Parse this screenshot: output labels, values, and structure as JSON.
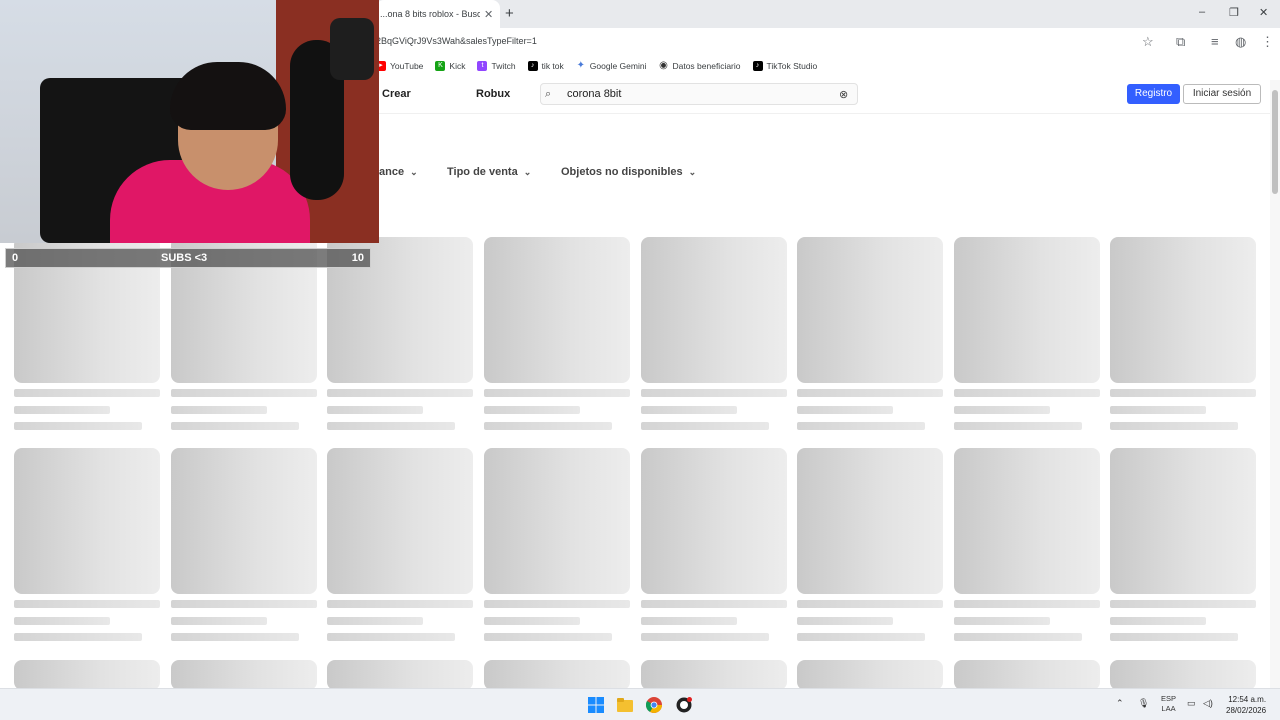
{
  "browser": {
    "tab_title": "...ona 8 bits roblox - Buscar c...",
    "tab_close": "✕",
    "new_tab": "+",
    "url": "2BqGViQrJ9Vs3Wah&salesTypeFilter=1",
    "window_controls": [
      "–",
      "❐",
      "✕"
    ]
  },
  "bookmarks": [
    {
      "label": "YouTube",
      "icon": "youtube-icon",
      "color": "#ff0000"
    },
    {
      "label": "Kick",
      "icon": "kick-icon",
      "color": "#15a315"
    },
    {
      "label": "Twitch",
      "icon": "twitch-icon",
      "color": "#9146ff"
    },
    {
      "label": "tik tok",
      "icon": "tiktok-icon",
      "color": "#000000"
    },
    {
      "label": "Google Gemini",
      "icon": "gemini-icon",
      "color": "#4a7bd9"
    },
    {
      "label": "Datos beneficiario",
      "icon": "globe-icon",
      "color": "#333333"
    },
    {
      "label": "TikTok Studio",
      "icon": "tiktok-studio-icon",
      "color": "#000000"
    }
  ],
  "header": {
    "nav": [
      "Crear",
      "Robux"
    ],
    "search_value": "corona 8bit",
    "register_label": "Registro",
    "login_label": "Iniciar sesión",
    "accent": "#335fff"
  },
  "filters": [
    "ance",
    "Tipo de venta",
    "Objetos no disponibles"
  ],
  "overlay": {
    "subs_left": "0",
    "subs_label": "SUBS <3",
    "subs_right": "10"
  },
  "taskbar": {
    "lang": "ESP",
    "lang_sub": "LAA",
    "time": "12:54 a.m.",
    "date": "28/02/2026"
  }
}
